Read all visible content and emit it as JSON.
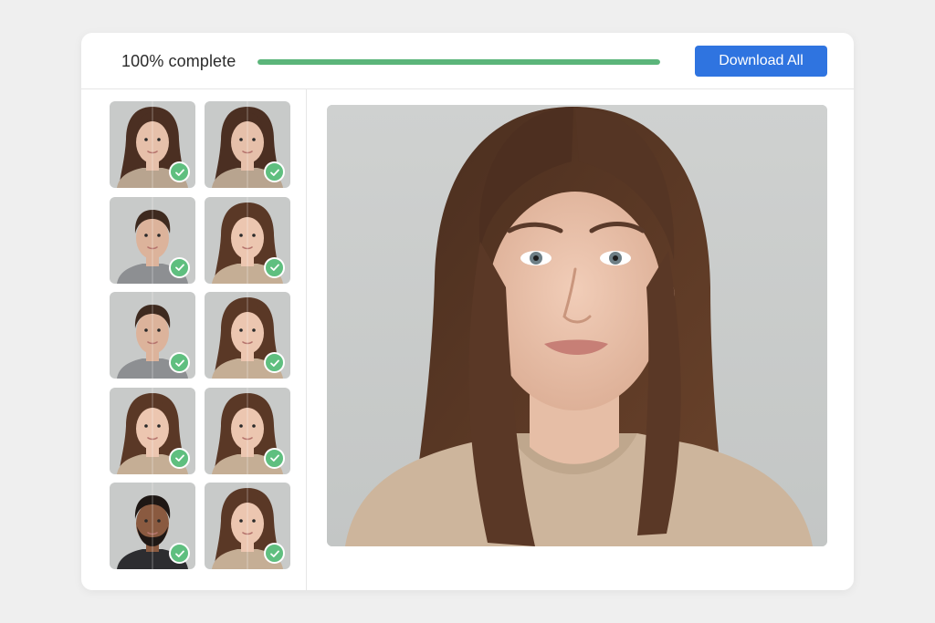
{
  "header": {
    "progress_label": "100% complete",
    "progress_value": 1.0,
    "download_button_label": "Download All"
  },
  "colors": {
    "accent": "#2f74e0",
    "progress": "#5bb57a",
    "success": "#5fbf7f"
  },
  "thumbnails": [
    {
      "subject": "woman-dark-hair",
      "status": "complete",
      "icon": "check-icon",
      "selected": false
    },
    {
      "subject": "woman-dark-hair",
      "status": "complete",
      "icon": "check-icon",
      "selected": false
    },
    {
      "subject": "man-short-hair",
      "status": "complete",
      "icon": "check-icon",
      "selected": false
    },
    {
      "subject": "woman-long-hair",
      "status": "complete",
      "icon": "check-icon",
      "selected": false
    },
    {
      "subject": "man-short-hair",
      "status": "complete",
      "icon": "check-icon",
      "selected": false
    },
    {
      "subject": "woman-long-hair",
      "status": "complete",
      "icon": "check-icon",
      "selected": false
    },
    {
      "subject": "woman-long-hair",
      "status": "complete",
      "icon": "check-icon",
      "selected": false
    },
    {
      "subject": "woman-long-hair",
      "status": "complete",
      "icon": "check-icon",
      "selected": false
    },
    {
      "subject": "man-beard",
      "status": "complete",
      "icon": "check-icon",
      "selected": false
    },
    {
      "subject": "woman-long-hair",
      "status": "complete",
      "icon": "check-icon",
      "selected": true
    }
  ],
  "preview": {
    "subject": "woman-long-brown-hair-beige-sweater"
  }
}
